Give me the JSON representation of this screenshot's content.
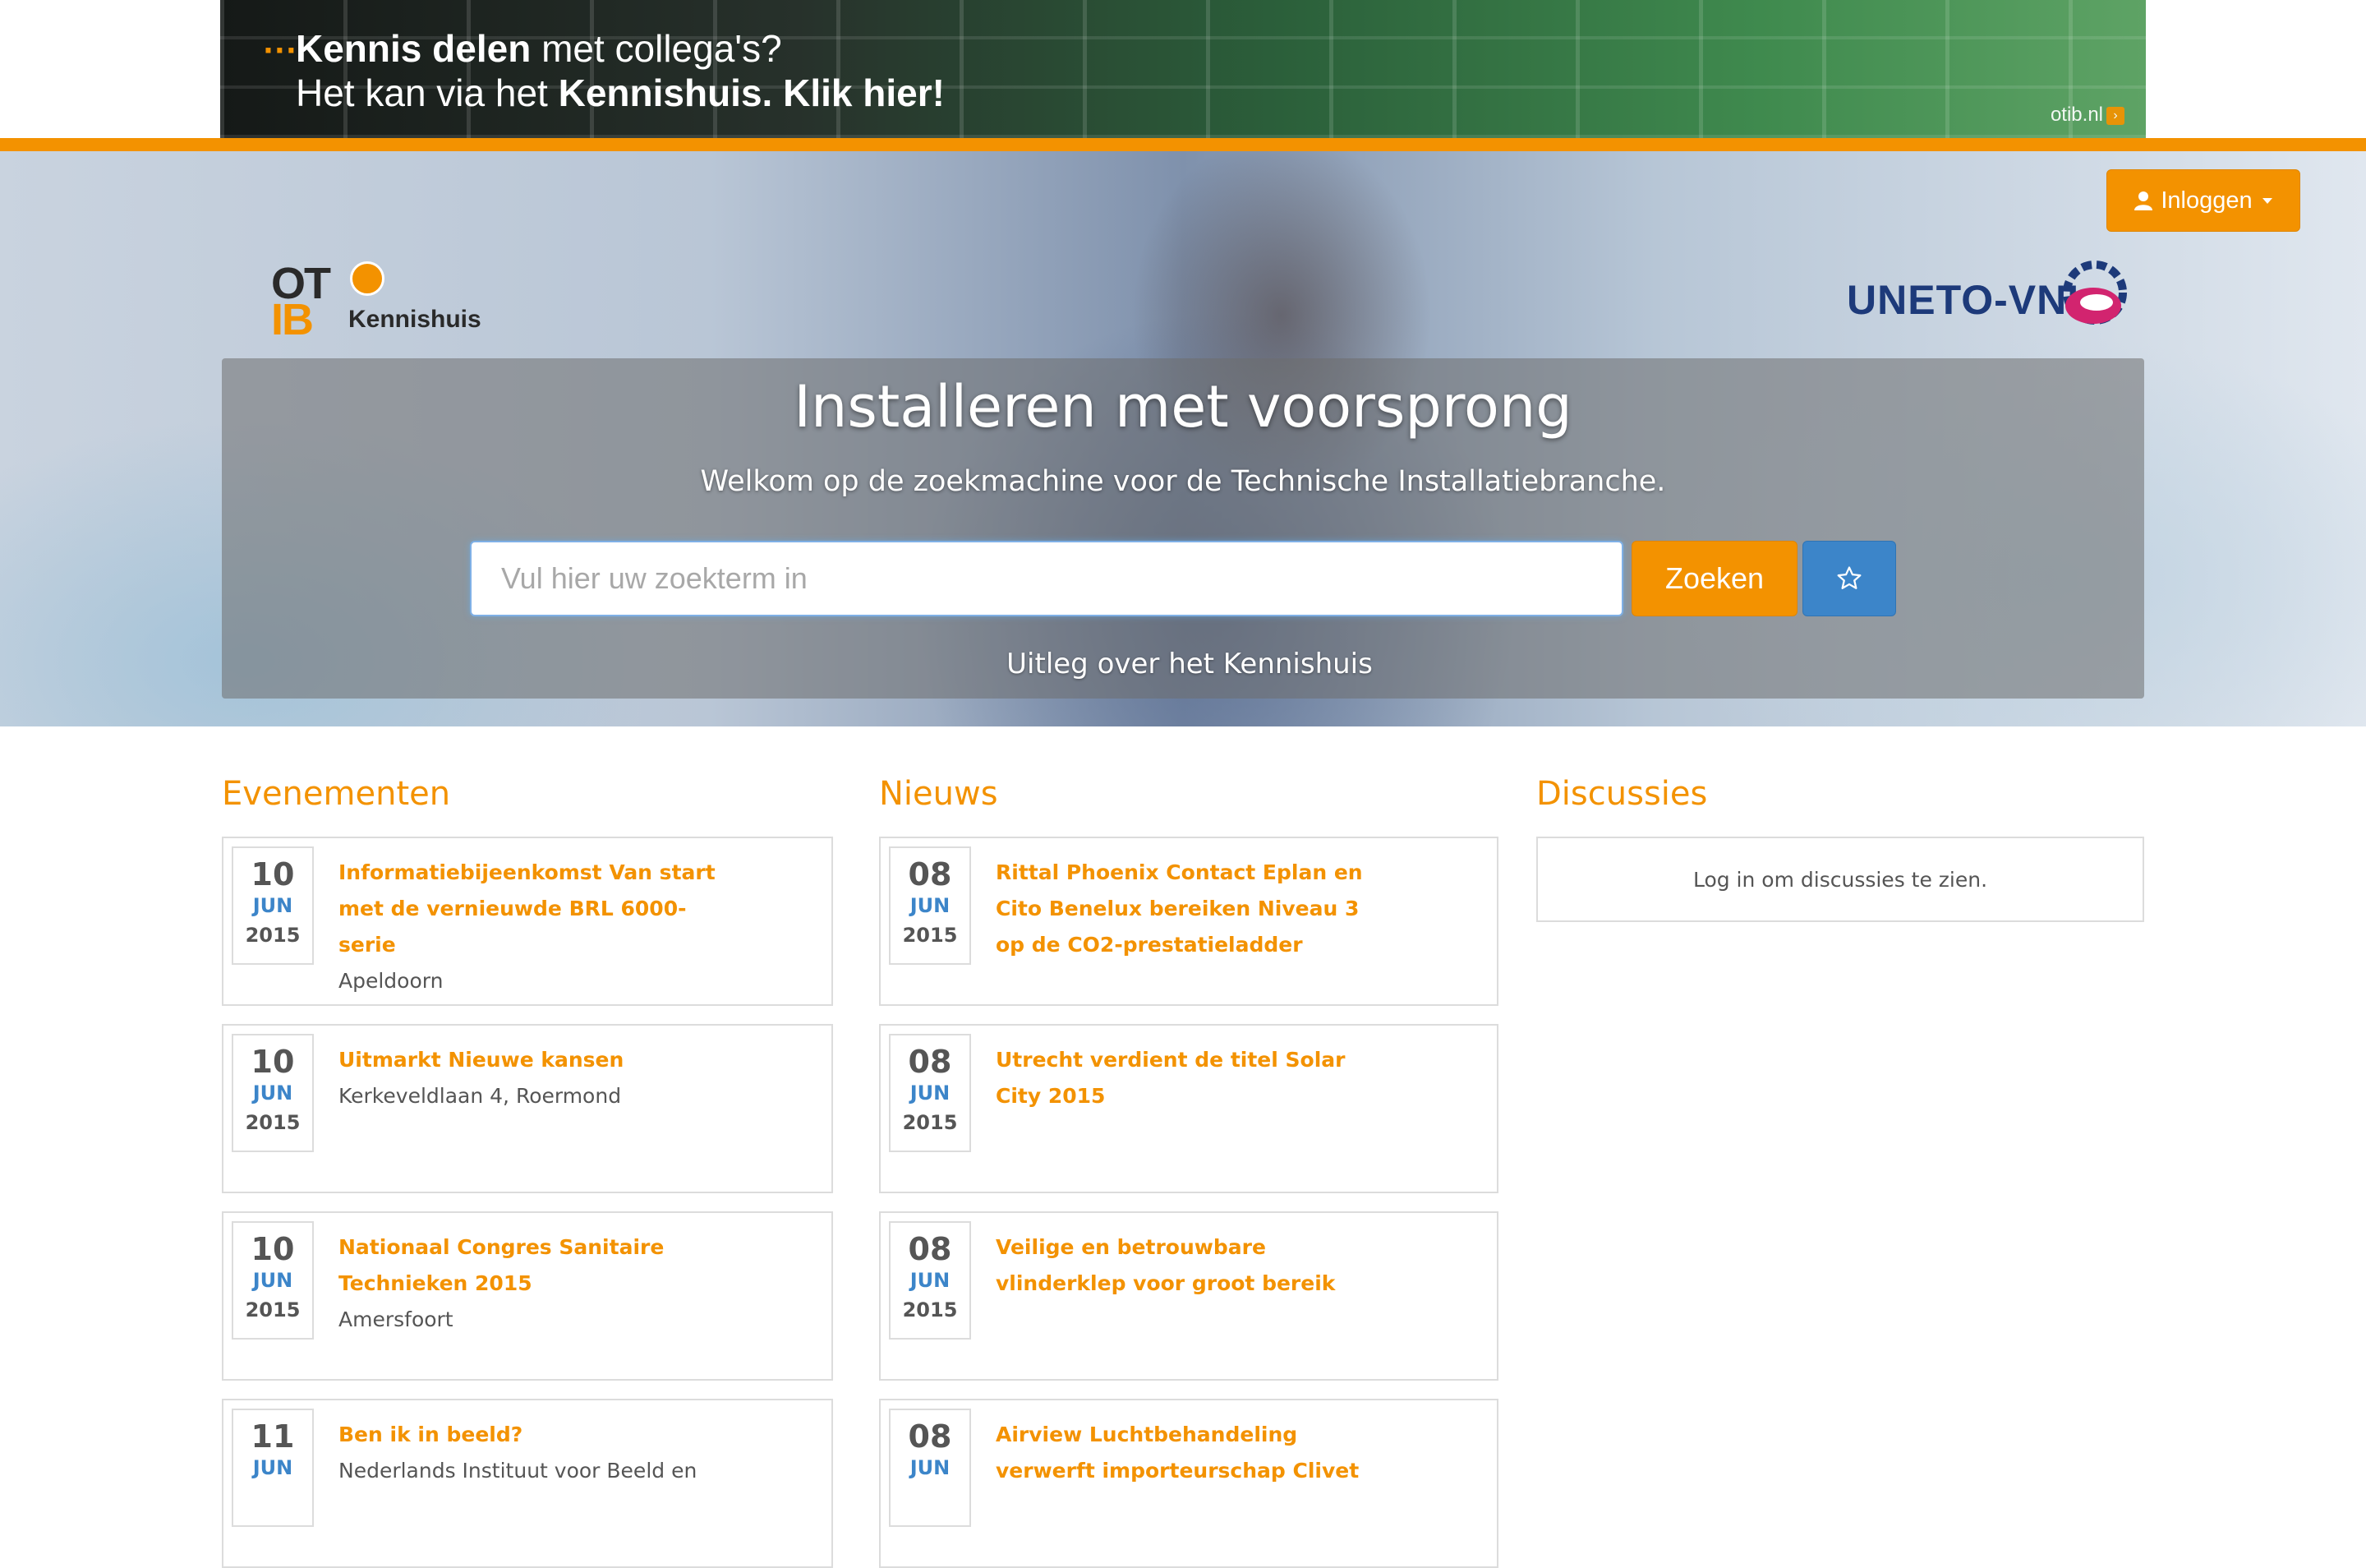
{
  "banner": {
    "line1_bold": "Kennis delen",
    "line1_rest": " met collega's?",
    "line2_start": "Het kan via het ",
    "line2_bold": "Kennishuis. Klik hier!",
    "site": "otib.nl"
  },
  "header": {
    "login_label": "Inloggen",
    "logo_left_ot": "OT",
    "logo_left_ib": "IB",
    "logo_left_name": "Kennishuis",
    "logo_right": "UNETO-VNI"
  },
  "hero": {
    "title": "Installeren met voorsprong",
    "subtitle": "Welkom op de zoekmachine voor de Technische Installatiebranche.",
    "search_placeholder": "Vul hier uw zoekterm in",
    "search_button": "Zoeken",
    "explain_link": "Uitleg over het Kennishuis"
  },
  "colors": {
    "accent": "#f39200",
    "blue": "#3c85c9"
  },
  "events": {
    "heading": "Evenementen",
    "items": [
      {
        "day": "10",
        "month": "JUN",
        "year": "2015",
        "title": "Informatiebijeenkomst Van start met de vernieuwde BRL 6000-serie",
        "location": "Apeldoorn"
      },
      {
        "day": "10",
        "month": "JUN",
        "year": "2015",
        "title": "Uitmarkt Nieuwe kansen",
        "location": "Kerkeveldlaan 4, Roermond"
      },
      {
        "day": "10",
        "month": "JUN",
        "year": "2015",
        "title": "Nationaal Congres Sanitaire Technieken 2015",
        "location": "Amersfoort"
      },
      {
        "day": "11",
        "month": "JUN",
        "year": "",
        "title": "Ben ik in beeld?",
        "location": "Nederlands Instituut voor Beeld en"
      }
    ]
  },
  "news": {
    "heading": "Nieuws",
    "items": [
      {
        "day": "08",
        "month": "JUN",
        "year": "2015",
        "title": "Rittal Phoenix Contact Eplan en Cito Benelux bereiken Niveau 3 op de CO2-prestatieladder"
      },
      {
        "day": "08",
        "month": "JUN",
        "year": "2015",
        "title": "Utrecht verdient de titel Solar City 2015"
      },
      {
        "day": "08",
        "month": "JUN",
        "year": "2015",
        "title": "Veilige en betrouwbare vlinderklep voor groot bereik"
      },
      {
        "day": "08",
        "month": "JUN",
        "year": "",
        "title": "Airview Luchtbehandeling verwerft importeurschap Clivet"
      }
    ]
  },
  "discussions": {
    "heading": "Discussies",
    "message": "Log in om discussies te zien."
  }
}
